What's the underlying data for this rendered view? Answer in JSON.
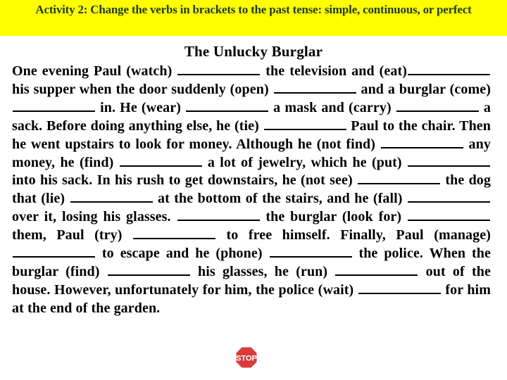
{
  "title": "Activity 2: Change the verbs in brackets to the past tense: simple, continuous, or perfect",
  "heading": "The Unlucky Burglar",
  "segments": [
    "One evening Paul (watch) ",
    " the television and (eat)",
    " his supper when the door suddenly (open) ",
    " and a burglar (come) ",
    " in. He (wear) ",
    " a mask and (carry) ",
    " a sack. Before doing anything else, he (tie) ",
    " Paul to the chair. Then he went upstairs to look for money. Although he (not find) ",
    " any money, he (find) ",
    " a lot of jewelry, which he (put) ",
    " into his sack. In his rush to get downstairs, he (not see) ",
    " the dog that (lie) ",
    " at the bottom of the stairs, and he (fall) ",
    " over it, losing his glasses. ",
    " the burglar (look for) ",
    " them, Paul (try) ",
    " to free himself. Finally, Paul (manage) ",
    " to escape and he (phone) ",
    " the police. When the burglar (find) ",
    " his glasses, he (run) ",
    " out of the house. However, unfortunately for him, the police (wait) ",
    " for him at the end of the garden."
  ],
  "stop_sign": {
    "icon": "stop-sign-icon",
    "label": "STOP",
    "color": "#d93a3a"
  },
  "colors": {
    "title_bg": "#ffff00",
    "title_text": "#1f3a1f"
  }
}
